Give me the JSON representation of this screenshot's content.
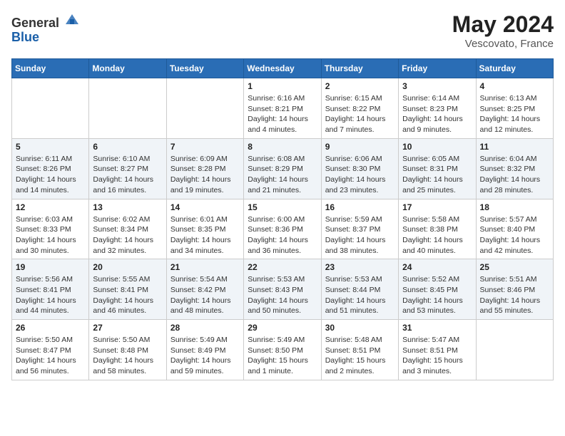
{
  "header": {
    "logo_line1": "General",
    "logo_line2": "Blue",
    "month_title": "May 2024",
    "location": "Vescovato, France"
  },
  "weekdays": [
    "Sunday",
    "Monday",
    "Tuesday",
    "Wednesday",
    "Thursday",
    "Friday",
    "Saturday"
  ],
  "weeks": [
    [
      {
        "day": "",
        "info": ""
      },
      {
        "day": "",
        "info": ""
      },
      {
        "day": "",
        "info": ""
      },
      {
        "day": "1",
        "info": "Sunrise: 6:16 AM\nSunset: 8:21 PM\nDaylight: 14 hours\nand 4 minutes."
      },
      {
        "day": "2",
        "info": "Sunrise: 6:15 AM\nSunset: 8:22 PM\nDaylight: 14 hours\nand 7 minutes."
      },
      {
        "day": "3",
        "info": "Sunrise: 6:14 AM\nSunset: 8:23 PM\nDaylight: 14 hours\nand 9 minutes."
      },
      {
        "day": "4",
        "info": "Sunrise: 6:13 AM\nSunset: 8:25 PM\nDaylight: 14 hours\nand 12 minutes."
      }
    ],
    [
      {
        "day": "5",
        "info": "Sunrise: 6:11 AM\nSunset: 8:26 PM\nDaylight: 14 hours\nand 14 minutes."
      },
      {
        "day": "6",
        "info": "Sunrise: 6:10 AM\nSunset: 8:27 PM\nDaylight: 14 hours\nand 16 minutes."
      },
      {
        "day": "7",
        "info": "Sunrise: 6:09 AM\nSunset: 8:28 PM\nDaylight: 14 hours\nand 19 minutes."
      },
      {
        "day": "8",
        "info": "Sunrise: 6:08 AM\nSunset: 8:29 PM\nDaylight: 14 hours\nand 21 minutes."
      },
      {
        "day": "9",
        "info": "Sunrise: 6:06 AM\nSunset: 8:30 PM\nDaylight: 14 hours\nand 23 minutes."
      },
      {
        "day": "10",
        "info": "Sunrise: 6:05 AM\nSunset: 8:31 PM\nDaylight: 14 hours\nand 25 minutes."
      },
      {
        "day": "11",
        "info": "Sunrise: 6:04 AM\nSunset: 8:32 PM\nDaylight: 14 hours\nand 28 minutes."
      }
    ],
    [
      {
        "day": "12",
        "info": "Sunrise: 6:03 AM\nSunset: 8:33 PM\nDaylight: 14 hours\nand 30 minutes."
      },
      {
        "day": "13",
        "info": "Sunrise: 6:02 AM\nSunset: 8:34 PM\nDaylight: 14 hours\nand 32 minutes."
      },
      {
        "day": "14",
        "info": "Sunrise: 6:01 AM\nSunset: 8:35 PM\nDaylight: 14 hours\nand 34 minutes."
      },
      {
        "day": "15",
        "info": "Sunrise: 6:00 AM\nSunset: 8:36 PM\nDaylight: 14 hours\nand 36 minutes."
      },
      {
        "day": "16",
        "info": "Sunrise: 5:59 AM\nSunset: 8:37 PM\nDaylight: 14 hours\nand 38 minutes."
      },
      {
        "day": "17",
        "info": "Sunrise: 5:58 AM\nSunset: 8:38 PM\nDaylight: 14 hours\nand 40 minutes."
      },
      {
        "day": "18",
        "info": "Sunrise: 5:57 AM\nSunset: 8:40 PM\nDaylight: 14 hours\nand 42 minutes."
      }
    ],
    [
      {
        "day": "19",
        "info": "Sunrise: 5:56 AM\nSunset: 8:41 PM\nDaylight: 14 hours\nand 44 minutes."
      },
      {
        "day": "20",
        "info": "Sunrise: 5:55 AM\nSunset: 8:41 PM\nDaylight: 14 hours\nand 46 minutes."
      },
      {
        "day": "21",
        "info": "Sunrise: 5:54 AM\nSunset: 8:42 PM\nDaylight: 14 hours\nand 48 minutes."
      },
      {
        "day": "22",
        "info": "Sunrise: 5:53 AM\nSunset: 8:43 PM\nDaylight: 14 hours\nand 50 minutes."
      },
      {
        "day": "23",
        "info": "Sunrise: 5:53 AM\nSunset: 8:44 PM\nDaylight: 14 hours\nand 51 minutes."
      },
      {
        "day": "24",
        "info": "Sunrise: 5:52 AM\nSunset: 8:45 PM\nDaylight: 14 hours\nand 53 minutes."
      },
      {
        "day": "25",
        "info": "Sunrise: 5:51 AM\nSunset: 8:46 PM\nDaylight: 14 hours\nand 55 minutes."
      }
    ],
    [
      {
        "day": "26",
        "info": "Sunrise: 5:50 AM\nSunset: 8:47 PM\nDaylight: 14 hours\nand 56 minutes."
      },
      {
        "day": "27",
        "info": "Sunrise: 5:50 AM\nSunset: 8:48 PM\nDaylight: 14 hours\nand 58 minutes."
      },
      {
        "day": "28",
        "info": "Sunrise: 5:49 AM\nSunset: 8:49 PM\nDaylight: 14 hours\nand 59 minutes."
      },
      {
        "day": "29",
        "info": "Sunrise: 5:49 AM\nSunset: 8:50 PM\nDaylight: 15 hours\nand 1 minute."
      },
      {
        "day": "30",
        "info": "Sunrise: 5:48 AM\nSunset: 8:51 PM\nDaylight: 15 hours\nand 2 minutes."
      },
      {
        "day": "31",
        "info": "Sunrise: 5:47 AM\nSunset: 8:51 PM\nDaylight: 15 hours\nand 3 minutes."
      },
      {
        "day": "",
        "info": ""
      }
    ]
  ]
}
